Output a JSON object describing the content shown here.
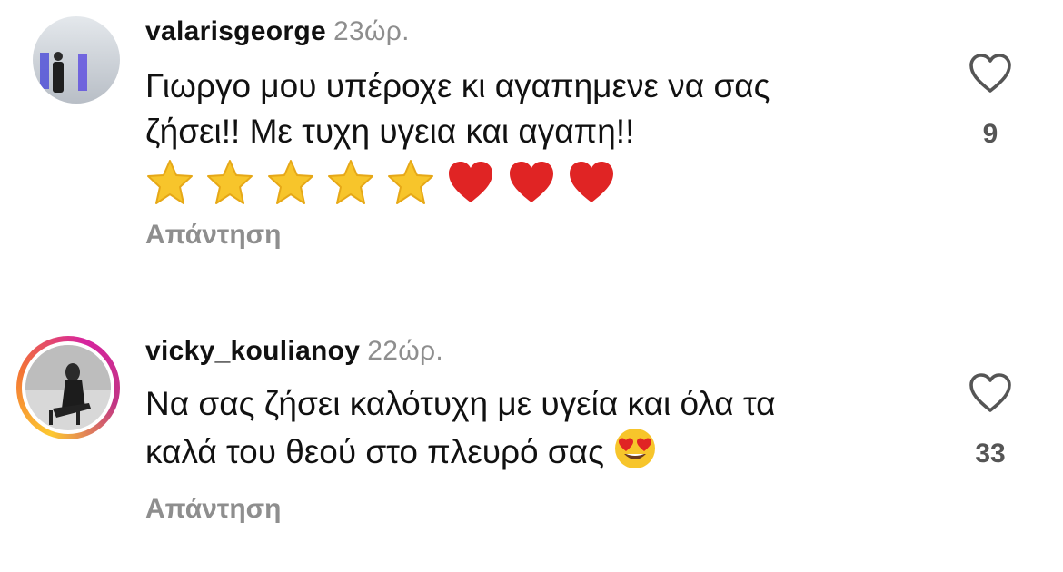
{
  "comments": [
    {
      "username": "valarisgeorge",
      "time": "23ώρ.",
      "text_lines": [
        "Γιωργο μου υπέροχε κι αγαπημενε να σας",
        "ζήσει!! Με τυχη υγεια και αγαπη!!"
      ],
      "emojis": [
        "star-emoji",
        "star-emoji",
        "star-emoji",
        "star-emoji",
        "star-emoji",
        "red-heart-emoji",
        "red-heart-emoji",
        "red-heart-emoji"
      ],
      "reply_label": "Απάντηση",
      "like_icon": "heart-outline-icon",
      "like_count": "9"
    },
    {
      "username": "vicky_koulianoy",
      "time": "22ώρ.",
      "text_lines": [
        "Να σας ζήσει καλότυχη με υγεία και όλα τα",
        "καλά του θεού στο πλευρό σας"
      ],
      "emojis": [
        "heart-eyes-emoji"
      ],
      "reply_label": "Απάντηση",
      "like_icon": "heart-outline-icon",
      "like_count": "33",
      "story_ring": true
    }
  ],
  "colors": {
    "secondary_text": "#8e8e8e",
    "heart_red": "#e02424",
    "star_yellow": "#f7c52b"
  }
}
